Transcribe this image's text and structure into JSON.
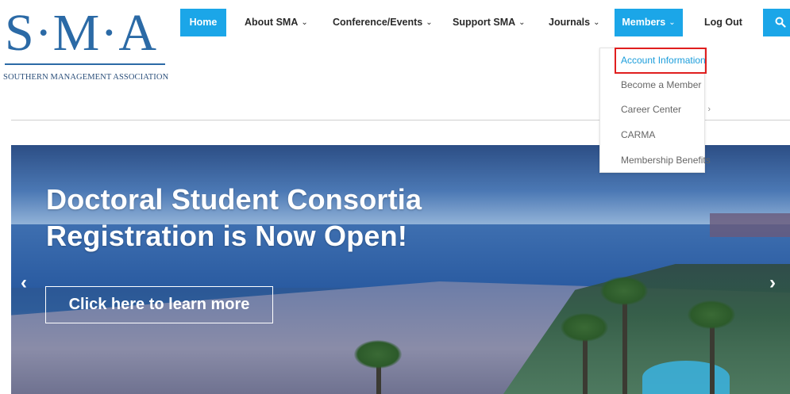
{
  "logo": {
    "letters": "S·M·A",
    "subtitle": "SOUTHERN MANAGEMENT ASSOCIATION"
  },
  "nav": {
    "home": "Home",
    "about": "About SMA",
    "conference": "Conference/Events",
    "support": "Support SMA",
    "journals": "Journals",
    "members": "Members",
    "logout": "Log Out",
    "chevron": "⌄",
    "search_icon": "search-icon"
  },
  "members_menu": {
    "items": [
      {
        "label": "Account Information"
      },
      {
        "label": "Become a Member"
      },
      {
        "label": "Career Center"
      },
      {
        "label": "CARMA"
      },
      {
        "label": "Membership Benefits"
      }
    ],
    "submenu_arrow": "›"
  },
  "hero": {
    "title_line1": "Doctoral Student Consortia",
    "title_line2": "Registration is Now Open!",
    "cta": "Click here to learn more",
    "prev": "‹",
    "next": "›"
  },
  "colors": {
    "accent": "#1ba6e8",
    "brand": "#2b6aa6",
    "highlight": "#e01f1f"
  }
}
